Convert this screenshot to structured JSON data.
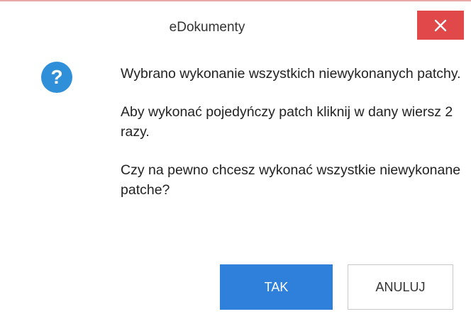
{
  "dialog": {
    "title": "eDokumenty",
    "message": {
      "line1": "Wybrano wykonanie wszystkich niewykonanych patchy.",
      "line2": "Aby wykonać pojedyńczy patch kliknij w dany wiersz 2 razy.",
      "line3": "Czy na pewno chcesz wykonać wszystkie niewykonane patche?"
    },
    "icon": "question-icon",
    "icon_glyph": "?",
    "buttons": {
      "yes_label": "TAK",
      "cancel_label": "ANULUJ"
    },
    "colors": {
      "close_bg": "#e0484a",
      "accent": "#2f80db",
      "icon_bg": "#2f8fd8"
    }
  }
}
